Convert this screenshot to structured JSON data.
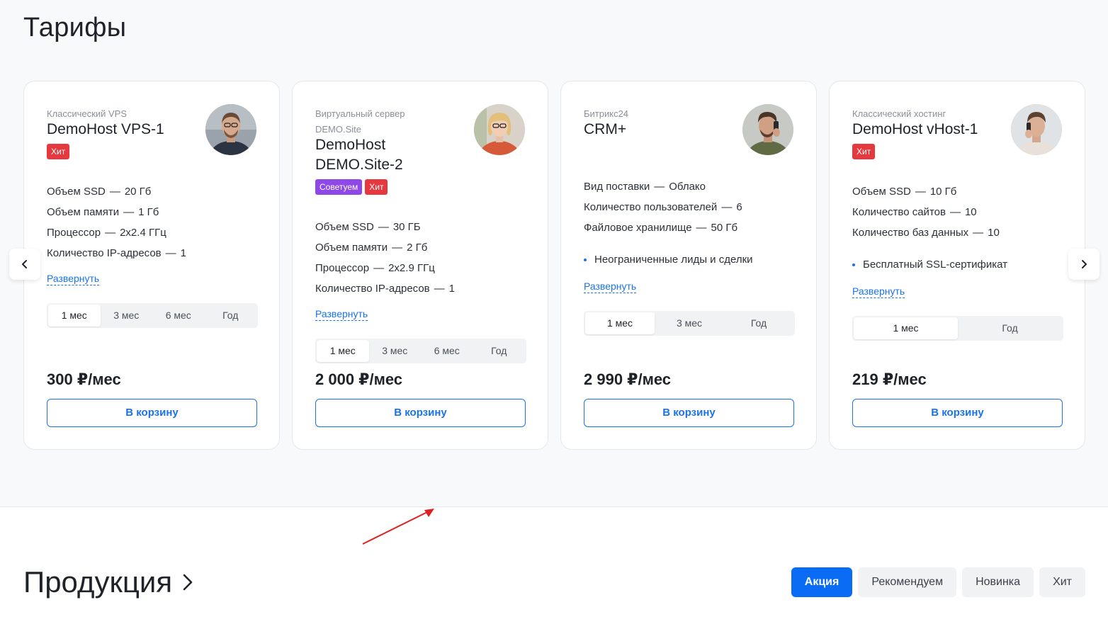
{
  "tariffs": {
    "title": "Тарифы",
    "cart_label": "В корзину",
    "expand_label": "Развернуть",
    "cards": [
      {
        "category": "Классический VPS",
        "name": "DemoHost VPS-1",
        "badges": [
          "Хит"
        ],
        "specs": [
          {
            "label": "Объем SSD",
            "value": "20 Гб"
          },
          {
            "label": "Объем памяти",
            "value": "1 Гб"
          },
          {
            "label": "Процессор",
            "value": "2x2.4 ГГц"
          },
          {
            "label": "Количество IP-адресов",
            "value": "1"
          }
        ],
        "periods": [
          "1 мес",
          "3 мес",
          "6 мес",
          "Год"
        ],
        "active_period": "1 мес",
        "price": "300 ₽/мес"
      },
      {
        "category": "Виртуальный сервер DEMO.Site",
        "name": "DemoHost DEMO.Site-2",
        "badges": [
          "Советуем",
          "Хит"
        ],
        "specs": [
          {
            "label": "Объем SSD",
            "value": "30 ГБ"
          },
          {
            "label": "Объем памяти",
            "value": "2 Гб"
          },
          {
            "label": "Процессор",
            "value": "2x2.9 ГГц"
          },
          {
            "label": "Количество IP-адресов",
            "value": "1"
          }
        ],
        "periods": [
          "1 мес",
          "3 мес",
          "6 мес",
          "Год"
        ],
        "active_period": "1 мес",
        "price": "2 000 ₽/мес"
      },
      {
        "category": "Битрикс24",
        "name": "CRM+",
        "badges": [],
        "specs": [
          {
            "label": "Вид поставки",
            "value": "Облако"
          },
          {
            "label": "Количество пользователей",
            "value": "6"
          },
          {
            "label": "Файловое хранилище",
            "value": "50 Гб"
          }
        ],
        "feature": "Неограниченные лиды и сделки",
        "periods": [
          "1 мес",
          "3 мес",
          "Год"
        ],
        "active_period": "1 мес",
        "price": "2 990 ₽/мес"
      },
      {
        "category": "Классический хостинг",
        "name": "DemoHost vHost-1",
        "badges": [
          "Хит"
        ],
        "specs": [
          {
            "label": "Объем SSD",
            "value": "10 Гб"
          },
          {
            "label": "Количество сайтов",
            "value": "10"
          },
          {
            "label": "Количество баз данных",
            "value": "10"
          }
        ],
        "feature": "Бесплатный SSL-сертификат",
        "periods": [
          "1 мес",
          "Год"
        ],
        "active_period": "1 мес",
        "price": "219 ₽/мес"
      }
    ]
  },
  "products": {
    "title": "Продукция",
    "filters": [
      "Акция",
      "Рекомендуем",
      "Новинка",
      "Хит"
    ],
    "active_filter": "Акция"
  },
  "colors": {
    "accent": "#1a73e8",
    "hit": "#e5393f",
    "recommend": "#8f48e8",
    "annotation": "#e02020"
  }
}
